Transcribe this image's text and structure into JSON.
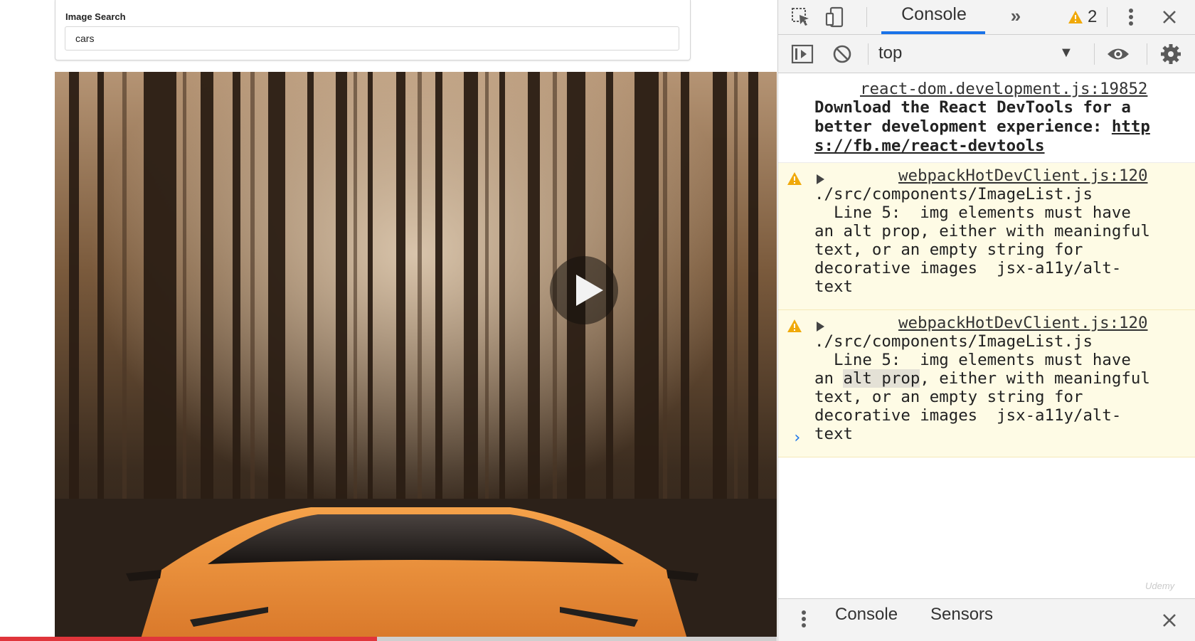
{
  "app": {
    "search_label": "Image Search",
    "search_value": "cars"
  },
  "video": {
    "progress_fraction": 0.485
  },
  "devtools": {
    "tabs": {
      "console_label": "Console",
      "more_tabs_label": "»"
    },
    "warning_count": "2",
    "context": "top",
    "messages": {
      "info": {
        "source": "react-dom.development.js:19852",
        "lines": [
          "Download the React DevTools for a",
          "better development experience: ",
          "s://fb.me/react-devtools"
        ],
        "link_start": "http"
      },
      "warnings": [
        {
          "source": "webpackHotDevClient.js:120",
          "lines": [
            "./src/components/ImageList.js",
            "  Line 5:  img elements must have",
            "an alt prop, either with meaningful",
            "text, or an empty string for",
            "decorative images  jsx-a11y/alt-",
            "text"
          ]
        },
        {
          "source": "webpackHotDevClient.js:120",
          "lines": [
            "./src/components/ImageList.js",
            "  Line 5:  img elements must have",
            "an ",
            "alt prop",
            ", either with meaningful",
            "text, or an empty string for",
            "decorative images  jsx-a11y/alt-",
            "text"
          ]
        }
      ]
    },
    "prompt_symbol": "›",
    "drawer": {
      "tab1": "Console",
      "tab2": "Sensors"
    },
    "watermark": "Udemy"
  },
  "colors": {
    "accent_blue": "#1a73e8",
    "warning_bg": "#fefbe5",
    "warning_icon": "#f0a90a",
    "progress_red": "#e0353b"
  }
}
